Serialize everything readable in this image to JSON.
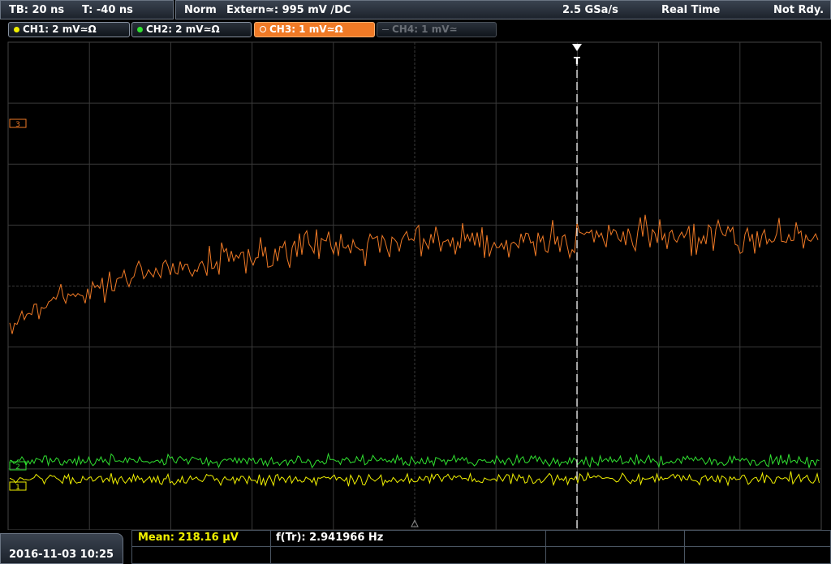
{
  "status_bar": {
    "timebase": "TB: 20 ns",
    "trigger_time": "T: -40 ns",
    "mode": "Norm",
    "trigger_source": "Extern≃: 995 mV ∕DC",
    "sample_rate": "2.5 GSa/s",
    "acquisition": "Real Time",
    "state": "Not Rdy."
  },
  "channels": [
    {
      "label": "CH1: 2 mV≃Ω",
      "color": "#f0f000",
      "active": true
    },
    {
      "label": "CH2: 2 mV≃Ω",
      "color": "#30e030",
      "active": true
    },
    {
      "label": "CH3: 1 mV≃Ω",
      "color": "#f07a26",
      "active": true
    },
    {
      "label": "CH4: 1 mV≃",
      "color": "#6a6f76",
      "active": false
    }
  ],
  "markers": {
    "ch3": "3",
    "ch2": "2",
    "ch1": "1",
    "trigger": "T"
  },
  "footer": {
    "datetime": "2016-11-03 10:25",
    "mean_label": "Mean: 218.16 µV",
    "freq_label": "f(Tr): 2.941966 Hz"
  }
}
